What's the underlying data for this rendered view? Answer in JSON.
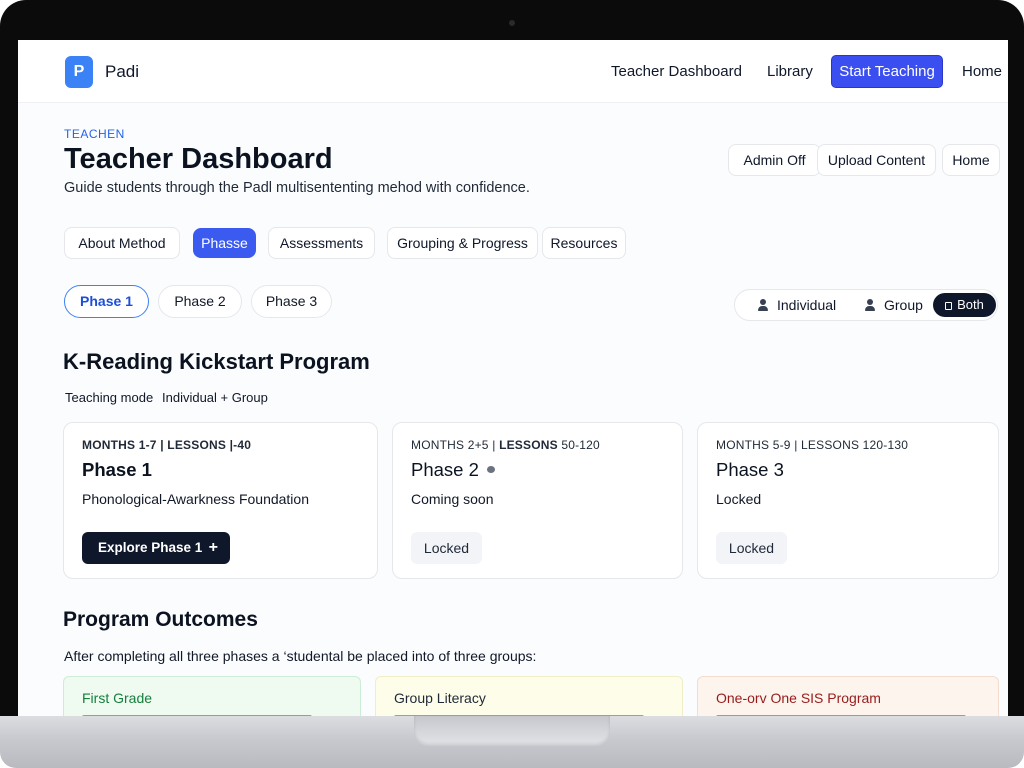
{
  "app": {
    "logo_letter": "P",
    "name": "Padi"
  },
  "nav": {
    "items": [
      "Teacher Dashboard",
      "Library"
    ],
    "cta": "Start Teaching",
    "home": "Home"
  },
  "header": {
    "eyebrow": "TEACHEN",
    "title": "Teacher Dashboard",
    "subtitle": "Guide students through the Padl multisententing mehod with confidence.",
    "actions": [
      "Admin Off",
      "Upload Content",
      "Home"
    ]
  },
  "tabs": [
    "About Method",
    "Phasse",
    "Assessments",
    "Grouping & Progress",
    "Resources"
  ],
  "active_tab": "Phasse",
  "phase_pills": [
    "Phase 1",
    "Phase 2",
    "Phase 3"
  ],
  "active_phase": "Phase 1",
  "mode_toggle": {
    "options": [
      "Individual",
      "Group",
      "Both"
    ],
    "selected": "Both"
  },
  "program": {
    "title": "K-Reading Kickstart Program",
    "mode_label": "Teaching mode",
    "mode_value": "Individual + Group"
  },
  "phases": [
    {
      "meta_prefix": "MONTHS 1-7 | LESSONS |-40",
      "title": "Phase 1",
      "desc": "Phonological-Awarkness Foundation",
      "button": "Explore Phase 1"
    },
    {
      "meta_prefix": "MONTHS 2+5 | ",
      "meta_bold": "LESSONS",
      "meta_suffix": " 50-120",
      "title": "Phase 2",
      "desc": "Coming soon",
      "badge": "Locked"
    },
    {
      "meta_prefix": "MONTHS 5-9 | LESSONS 120-130",
      "title": "Phase 3",
      "desc": "Locked",
      "badge": "Locked"
    }
  ],
  "outcomes": {
    "title": "Program Outcomes",
    "intro": "After completing all three phases a ‘studental be placed into of three groups:",
    "groups": [
      {
        "title": "First Grade",
        "color": "#15803d"
      },
      {
        "title": "Group Literacy",
        "color": "#1f2937"
      },
      {
        "title": "One-orv One SIS Program",
        "color": "#991b1b"
      }
    ]
  },
  "colors": {
    "accent": "#3b5bf0",
    "dark": "#0f172a",
    "logo": "#3b82f6"
  }
}
